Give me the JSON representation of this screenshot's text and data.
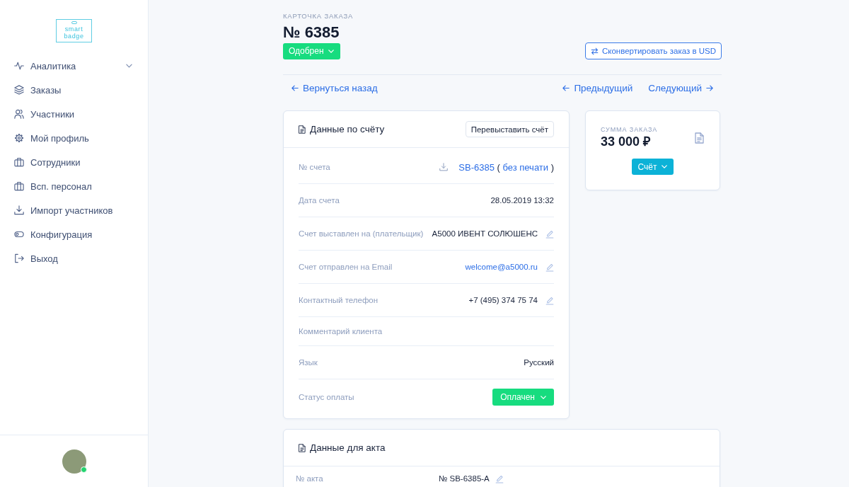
{
  "sidebar": {
    "logo": "smart badge",
    "items": [
      {
        "label": "Аналитика",
        "expandable": true
      },
      {
        "label": "Заказы",
        "expandable": false
      },
      {
        "label": "Участники",
        "expandable": false
      },
      {
        "label": "Мой профиль",
        "expandable": false
      },
      {
        "label": "Сотрудники",
        "expandable": false
      },
      {
        "label": "Всп. персонал",
        "expandable": false
      },
      {
        "label": "Импорт участников",
        "expandable": false
      },
      {
        "label": "Конфигурация",
        "expandable": false
      },
      {
        "label": "Выход",
        "expandable": false
      }
    ],
    "user": {
      "online": true
    }
  },
  "header": {
    "caption": "КАРТОЧКА ЗАКАЗА",
    "title": "№ 6385",
    "status": "Одобрен",
    "convert_button": "Сконвертировать заказ в USD"
  },
  "navigation": {
    "back": "Вернуться назад",
    "previous": "Предыдущий",
    "next": "Следующий"
  },
  "invoice_card": {
    "title": "Данные по счёту",
    "action": "Перевыставить счёт",
    "rows": [
      {
        "kind": "invoice",
        "label": "№ счета",
        "number": "SB-6385",
        "open": "(",
        "note": "без печати",
        "close": ")",
        "editable": false
      },
      {
        "kind": "text",
        "label": "Дата счета",
        "value": "28.05.2019 13:32",
        "editable": false
      },
      {
        "kind": "text",
        "label": "Счет выставлен на (плательщик)",
        "value": "А5000 ИВЕНТ СОЛЮШЕНС",
        "editable": true
      },
      {
        "kind": "link",
        "label": "Счет отправлен на Email",
        "value": "welcome@a5000.ru",
        "editable": true
      },
      {
        "kind": "text",
        "label": "Контактный телефон",
        "value": "+7 (495) 374 75 74",
        "editable": true
      },
      {
        "kind": "text",
        "label": "Комментарий клиента",
        "editable": false
      },
      {
        "kind": "text",
        "label": "Язык",
        "value": "Русский",
        "editable": false
      },
      {
        "kind": "status",
        "label": "Статус оплаты",
        "value": "Оплачен",
        "editable": false
      }
    ]
  },
  "summary_card": {
    "label": "СУММА ЗАКАЗА",
    "amount": "33 000 ₽",
    "button": "Счёт"
  },
  "act_card": {
    "title": "Данные для акта",
    "rows": [
      {
        "label": "№ акта",
        "value": "№ SB-6385-A",
        "editable": true
      }
    ]
  }
}
